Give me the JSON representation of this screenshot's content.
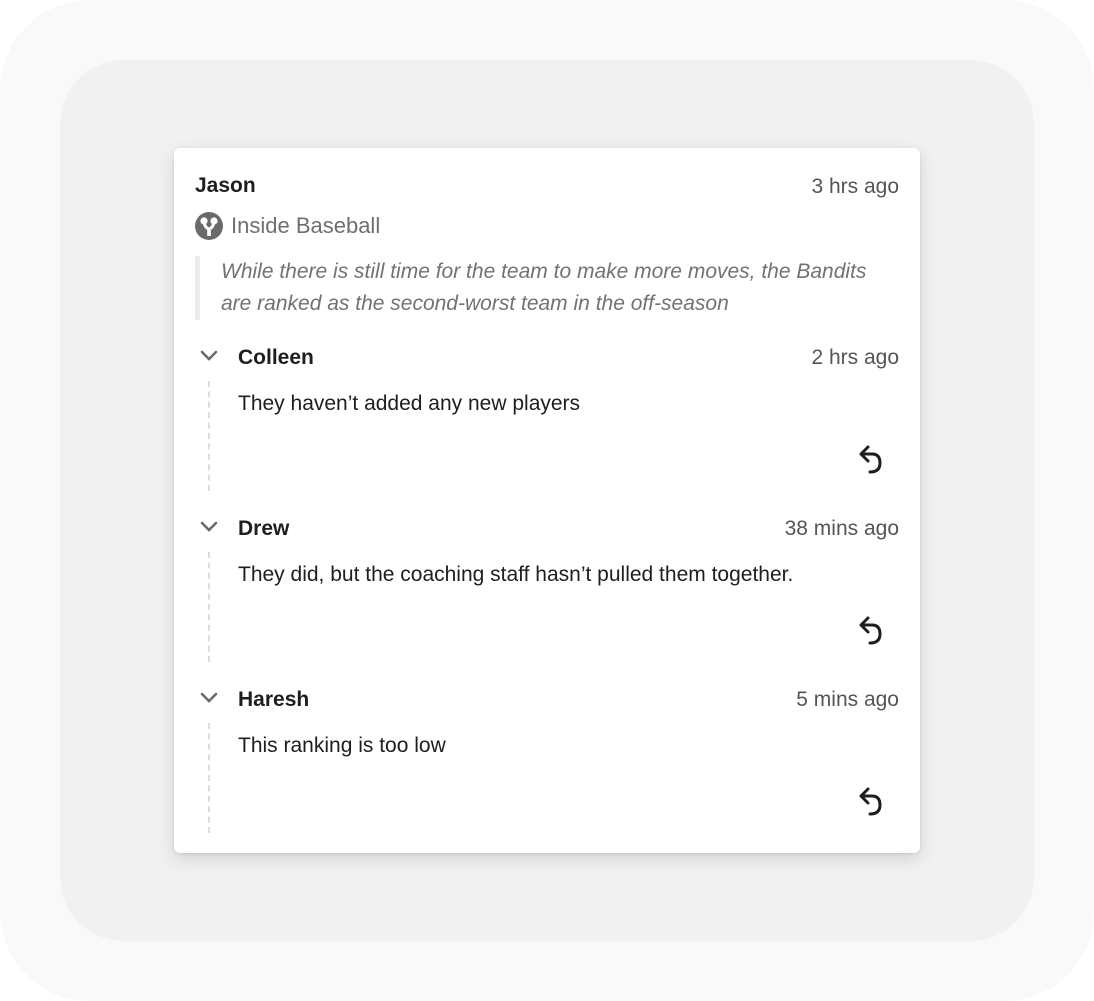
{
  "post": {
    "author": "Jason",
    "time": "3 hrs ago",
    "group": {
      "name": "Inside Baseball",
      "icon": "fork-icon"
    },
    "quote": "While there is still time for the team to make more moves, the Bandits are ranked as the second-worst team in the off-season"
  },
  "comments": [
    {
      "author": "Colleen",
      "time": "2 hrs ago",
      "body": "They haven’t added any new players",
      "reply_icon": "reply-icon"
    },
    {
      "author": "Drew",
      "time": "38 mins ago",
      "body": "They did, but the coaching staff hasn’t pulled them together.",
      "reply_icon": "reply-icon"
    },
    {
      "author": "Haresh",
      "time": "5 mins ago",
      "body": "This ranking is too low",
      "reply_icon": "reply-icon"
    }
  ],
  "colors": {
    "card_background": "#ffffff",
    "inner_frame": "#f1f1f1",
    "outer_frame": "#f9f9f9",
    "text_primary": "#1e1e1e",
    "text_muted": "#555555",
    "quote_text": "#727272",
    "icon": "#6a6a6a"
  }
}
